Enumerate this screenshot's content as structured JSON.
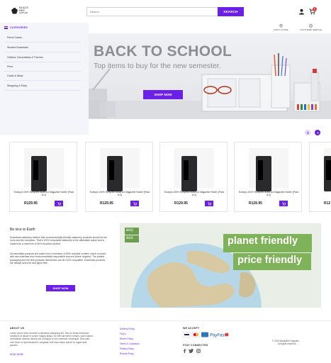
{
  "header": {
    "logo_text_1": "BLACK",
    "logo_text_2": "BEE",
    "logo_text_3": "SUPPLIES",
    "search_placeholder": "Search",
    "search_button": "SEARCH",
    "cart_count": "0"
  },
  "sidebar": {
    "title": "CATEGORIES",
    "items": [
      {
        "label": "Pencil Cases"
      },
      {
        "label": "Student Essentials"
      },
      {
        "label": "Clothes, Decorations & Themes"
      },
      {
        "label": "Pens"
      },
      {
        "label": "Cards & Wrap"
      },
      {
        "label": "Wrapping & Party"
      }
    ]
  },
  "util": {
    "stores": "FIND A STORE",
    "contact": "CUSTOMER SERVICE"
  },
  "banner": {
    "title": "BACK TO SCHOOL",
    "subtitle": "Top items to buy for the new semester.",
    "button": "SHOP NOW"
  },
  "products": [
    {
      "name": "Ecotoys 100% Recycled Black A4 Magazine Holder (Pack of 2)",
      "price": "R129.95"
    },
    {
      "name": "Ecotoys 100% Recycled Black A4 Magazine Holder (Pack of 2)",
      "price": "R129.95"
    },
    {
      "name": "Ecotoys 100% Recycled Black A4 Magazine Holder (Pack of 2)",
      "price": "R129.95"
    },
    {
      "name": "Ecotoys 100% Recycled Black A4 Magazine Holder (Pack of 2)",
      "price": "R129.95"
    },
    {
      "name": "",
      "price": "R12"
    }
  ],
  "eco": {
    "title": "Be nice to Earth",
    "p1": "Essentials stationery believe that environmentally-friendly stationery products should be the norm and the exception. That's 100% recyclable stationery is the affordable option and is made from a minimum of 80% recycled content.",
    "p2": "All essentials products are made from a minimum of 80% recycled content, which is mixed with raw materials from environmentally responsible sources where required. The printed packaging and the final products themselves are all 100% recyclable. Essentials products are always acid-free and lignin-free.",
    "button": "SHOP NOW",
    "badge_1": "eco",
    "badge_2": "eco",
    "tag_1": "planet friendly",
    "tag_2": "price friendly"
  },
  "footer": {
    "about_head": "ABOUT US",
    "about_text": "Lorem ipsum dolor sit amet consectetur adipiscing elit. Sed do eiusmod tempor incididunt ut labore et dolore magna aliqua. Ut enim ad minim veniam, quis nostrud exercitation ullamco laboris nisi ut aliquip ex ea commodo consequat. Duis aute irure dolor in reprehenderit in voluptate velit esse cillum dolore eu fugiat nulla pariatur.",
    "about_link": "READ MORE",
    "links": [
      "Delivery Policy",
      "FAQ's",
      "Return Policy",
      "Terms & Conditions",
      "Privacy Policy",
      "Refund Policy"
    ],
    "accept_head": "WE ACCEPT",
    "connect_head": "STAY CONNECTED",
    "copyright_1": "© 2021 BlackBee Supplies",
    "copyright_2": "All rights reserved."
  },
  "colors": {
    "accent": "#6c1fe6",
    "sidebar_bg": "#f4f5fa"
  }
}
